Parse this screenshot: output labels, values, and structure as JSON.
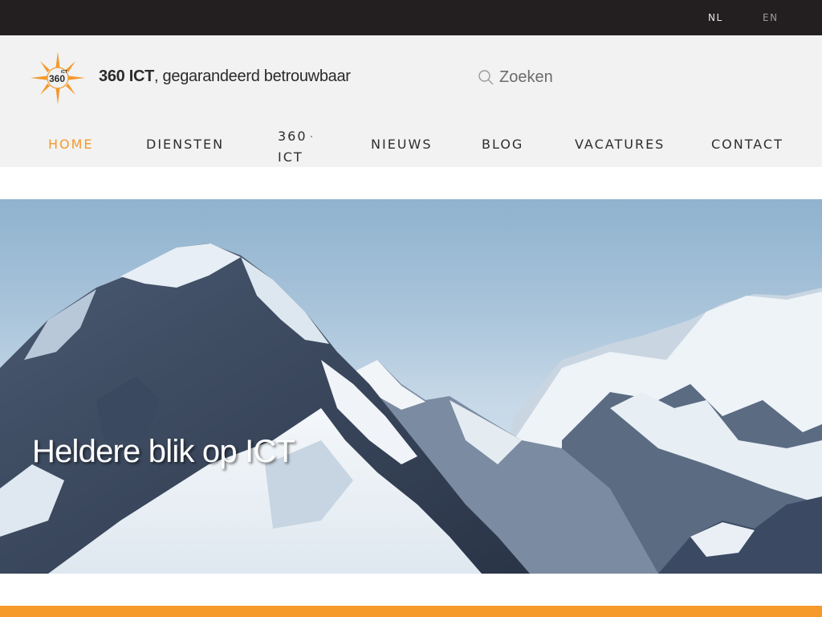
{
  "topbar": {
    "languages": [
      {
        "label": "NL",
        "active": true
      },
      {
        "label": "EN",
        "active": false
      }
    ]
  },
  "header": {
    "brand_name": "360 ICT",
    "brand_tagline": ", gegarandeerd betrouwbaar",
    "logo_text": "360",
    "logo_superscript": "ICT",
    "search": {
      "placeholder": "Zoeken",
      "value": ""
    }
  },
  "nav": {
    "items": [
      {
        "label": "HOME",
        "active": true
      },
      {
        "label": "DIENSTEN",
        "active": false
      },
      {
        "label": "360 ICT",
        "active": false,
        "has_dropdown": true
      },
      {
        "label": "NIEUWS",
        "active": false
      },
      {
        "label": "BLOG",
        "active": false
      },
      {
        "label": "VACATURES",
        "active": false
      },
      {
        "label": "CONTACT",
        "active": false
      }
    ]
  },
  "hero": {
    "title": "Heldere blik op ICT"
  },
  "colors": {
    "accent": "#f39a2c",
    "topbar": "#231f20",
    "header_bg": "#f2f2f2",
    "band": "#f59a2b"
  },
  "icons": {
    "search": "search-icon",
    "dropdown": "chevron-down-icon",
    "logo": "compass-star-logo"
  }
}
